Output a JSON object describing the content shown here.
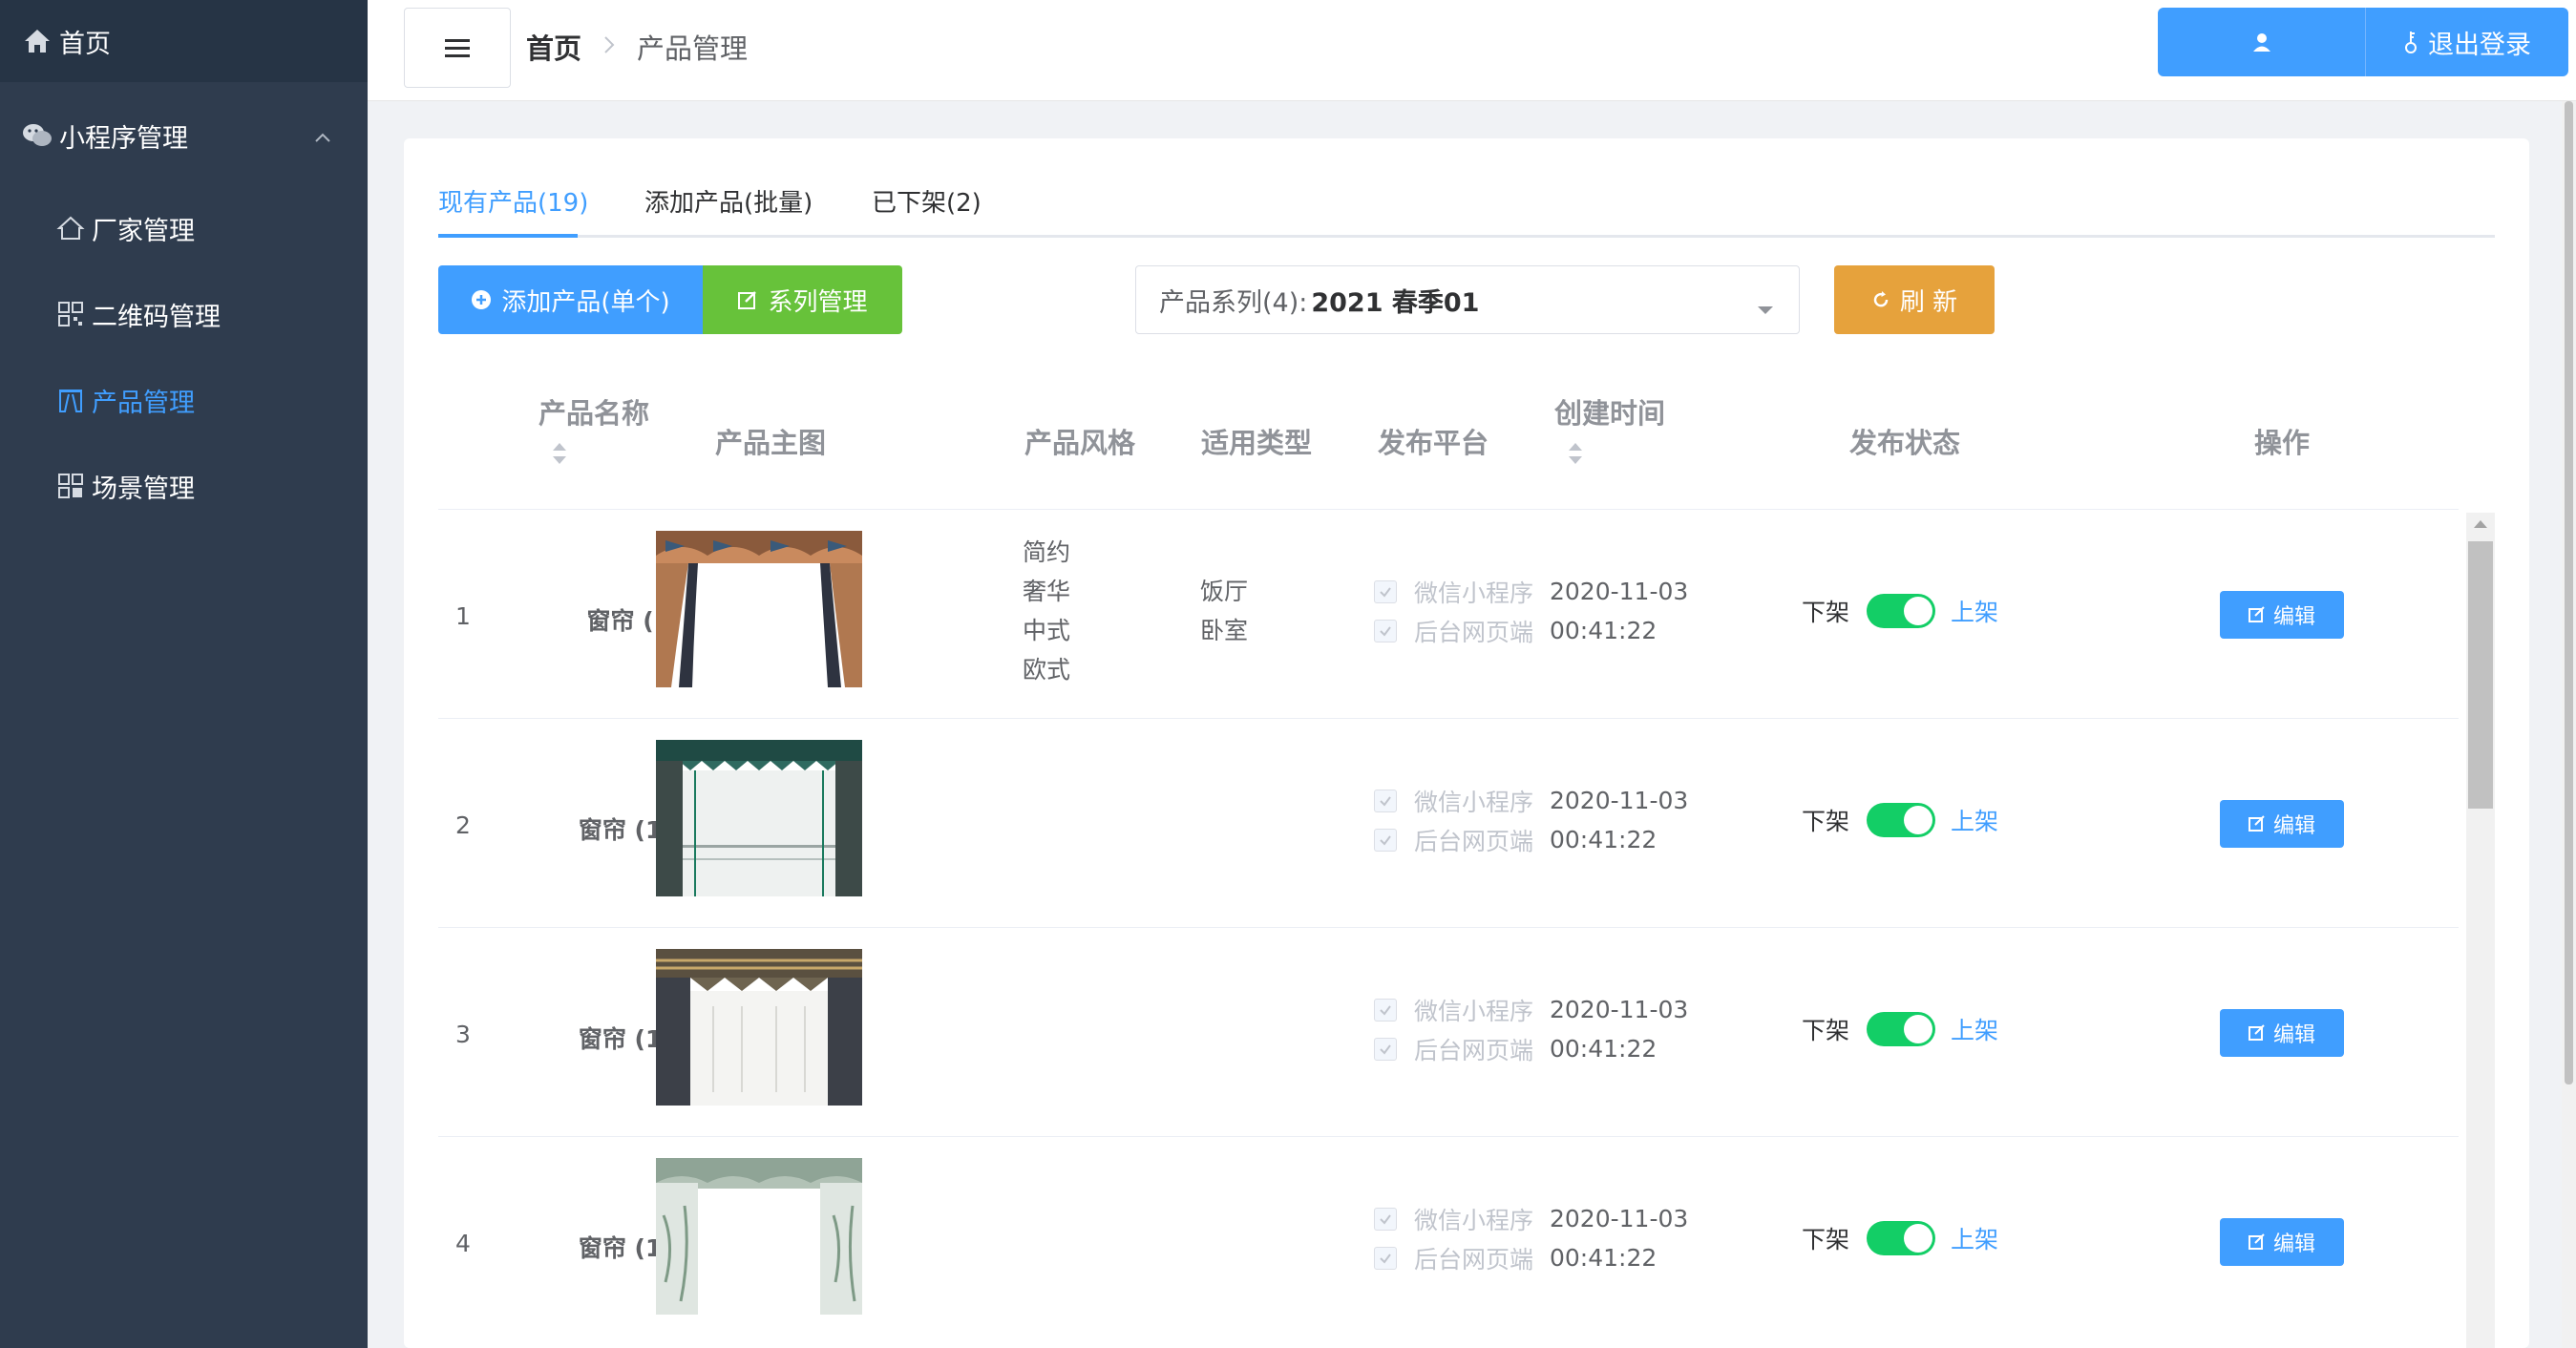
{
  "sidebar": {
    "home": "首页",
    "mini_program": "小程序管理",
    "items": [
      {
        "label": "厂家管理",
        "icon": "house-icon"
      },
      {
        "label": "二维码管理",
        "icon": "qrcode-icon"
      },
      {
        "label": "产品管理",
        "icon": "curtain-icon"
      },
      {
        "label": "场景管理",
        "icon": "grid-icon"
      }
    ]
  },
  "header": {
    "breadcrumb_home": "首页",
    "breadcrumb_current": "产品管理",
    "logout": "退出登录"
  },
  "tabs": [
    {
      "label": "现有产品(19)"
    },
    {
      "label": "添加产品(批量)"
    },
    {
      "label": "已下架(2)"
    }
  ],
  "toolbar": {
    "add_single": "添加产品(单个)",
    "series_manage": "系列管理",
    "select_label": "产品系列(4):",
    "select_value": "2021 春季01",
    "refresh": "刷 新"
  },
  "table": {
    "columns": {
      "name": "产品名称",
      "image": "产品主图",
      "style": "产品风格",
      "type": "适用类型",
      "platform": "发布平台",
      "created": "创建时间",
      "status": "发布状态",
      "action": "操作"
    },
    "platforms": [
      "微信小程序",
      "后台网页端"
    ],
    "status_off": "下架",
    "status_on": "上架",
    "edit": "编辑",
    "rows": [
      {
        "index": "1",
        "name": "窗帘 (1);",
        "styles": [
          "简约",
          "奢华",
          "中式",
          "欧式"
        ],
        "types": [
          "饭厅",
          "卧室"
        ],
        "date": "2020-11-03",
        "time": "00:41:22",
        "published": true
      },
      {
        "index": "2",
        "name": "窗帘 (10);",
        "styles": [],
        "types": [],
        "date": "2020-11-03",
        "time": "00:41:22",
        "published": true
      },
      {
        "index": "3",
        "name": "窗帘 (11);",
        "styles": [],
        "types": [],
        "date": "2020-11-03",
        "time": "00:41:22",
        "published": true
      },
      {
        "index": "4",
        "name": "窗帘 (12);",
        "styles": [],
        "types": [],
        "date": "2020-11-03",
        "time": "00:41:22",
        "published": true
      }
    ]
  },
  "colors": {
    "sidebar_bg": "#2f3c4e",
    "primary": "#409eff",
    "success": "#67c23a",
    "warning": "#e6a23c",
    "switch_on": "#13ce66"
  }
}
